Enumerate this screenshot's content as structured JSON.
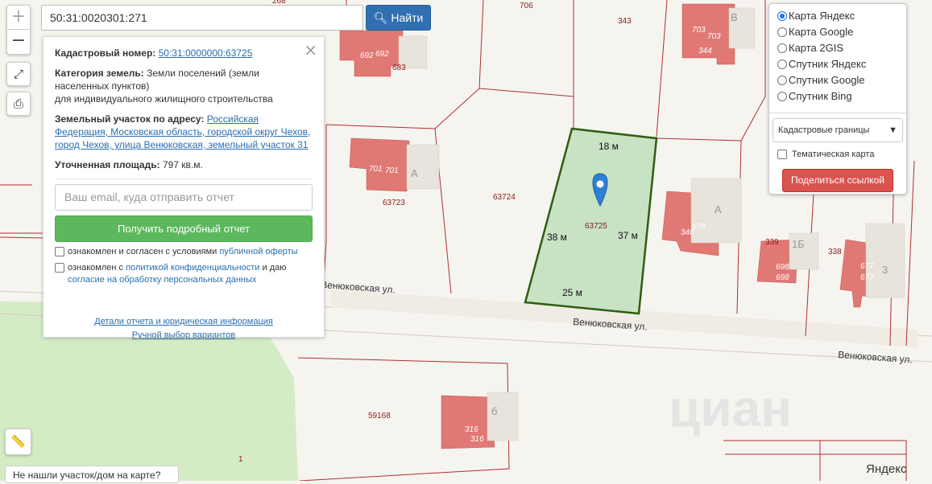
{
  "search": {
    "value": "50:31:0020301:271",
    "button_label": "Найти",
    "search_icon": "magnifier-icon"
  },
  "controls": {
    "zoom_in": "+",
    "zoom_out": "−",
    "fullscreen_icon": "expand-icon",
    "print_icon": "printer-icon",
    "ruler_icon": "ruler-icon"
  },
  "info_panel": {
    "close_label": "×",
    "cadastral_label": "Кадастровый номер:",
    "cadastral_value": "50:31:0000000:63725",
    "category_label": "Категория земель:",
    "category_value": "Земли поселений (земли населенных пунктов)",
    "category_purpose": "для индивидуального жилищного строительства",
    "address_label": "Земельный участок по адресу:",
    "address_value": "Российская Федерация, Московская область, городской округ Чехов, город Чехов, улица Венюковская, земельный участок 31",
    "area_label": "Уточненная площадь:",
    "area_value": "797 кв.м.",
    "email_placeholder": "Ваш email, куда отправить отчет",
    "report_button": "Получить подробный отчет",
    "consent1_text": "ознакомлен и согласен с условиями",
    "consent1_link": "публичной оферты",
    "consent2_text": "ознакомлен с",
    "consent2_link": "политикой конфиденциальности",
    "consent2_mid": "и даю",
    "consent2_link2": "согласие на обработку персональных данных",
    "details_link": "Детали отчета и юридическая информация",
    "manual_link": "Ручной выбор вариантов"
  },
  "layers": {
    "options": [
      {
        "label": "Карта Яндекс",
        "selected": true
      },
      {
        "label": "Карта Google",
        "selected": false
      },
      {
        "label": "Карта 2GIS",
        "selected": false
      },
      {
        "label": "Спутник Яндекс",
        "selected": false
      },
      {
        "label": "Спутник Google",
        "selected": false
      },
      {
        "label": "Спутник Bing",
        "selected": false
      }
    ],
    "overlay_select": "Кадастровые границы",
    "thematic_label": "Тематическая карта",
    "thematic_checked": false,
    "share_button": "Поделиться ссылкой"
  },
  "map": {
    "selected_parcel": "63725",
    "edge_top": "18 м",
    "edge_left": "38 м",
    "edge_right": "37 м",
    "edge_bottom": "25 м",
    "parcel_labels": [
      "63724",
      "63723",
      "59168",
      "706",
      "343",
      "338",
      "339",
      "340",
      "1"
    ],
    "building_labels": [
      "692",
      "692",
      "683",
      "703",
      "703",
      "344",
      "701",
      "701",
      "678",
      "340",
      "698",
      "698",
      "677",
      "677",
      "316",
      "316",
      "268"
    ],
    "street_labels": [
      "Венюковская ул.",
      "Венюковская ул.",
      "Венюковская ул."
    ],
    "house_letters": [
      "В",
      "А",
      "А",
      "1Б",
      "3",
      "б",
      "О"
    ],
    "watermark": "циан",
    "provider": "Яндекс",
    "accent_green": "#5cb85c",
    "accent_blue": "#2f6fb2",
    "accent_red": "#d9534f",
    "parcel_fill": "#c8e2c4",
    "building_fill": "#e07874"
  },
  "not_found": "Не нашли участок/дом на карте?"
}
